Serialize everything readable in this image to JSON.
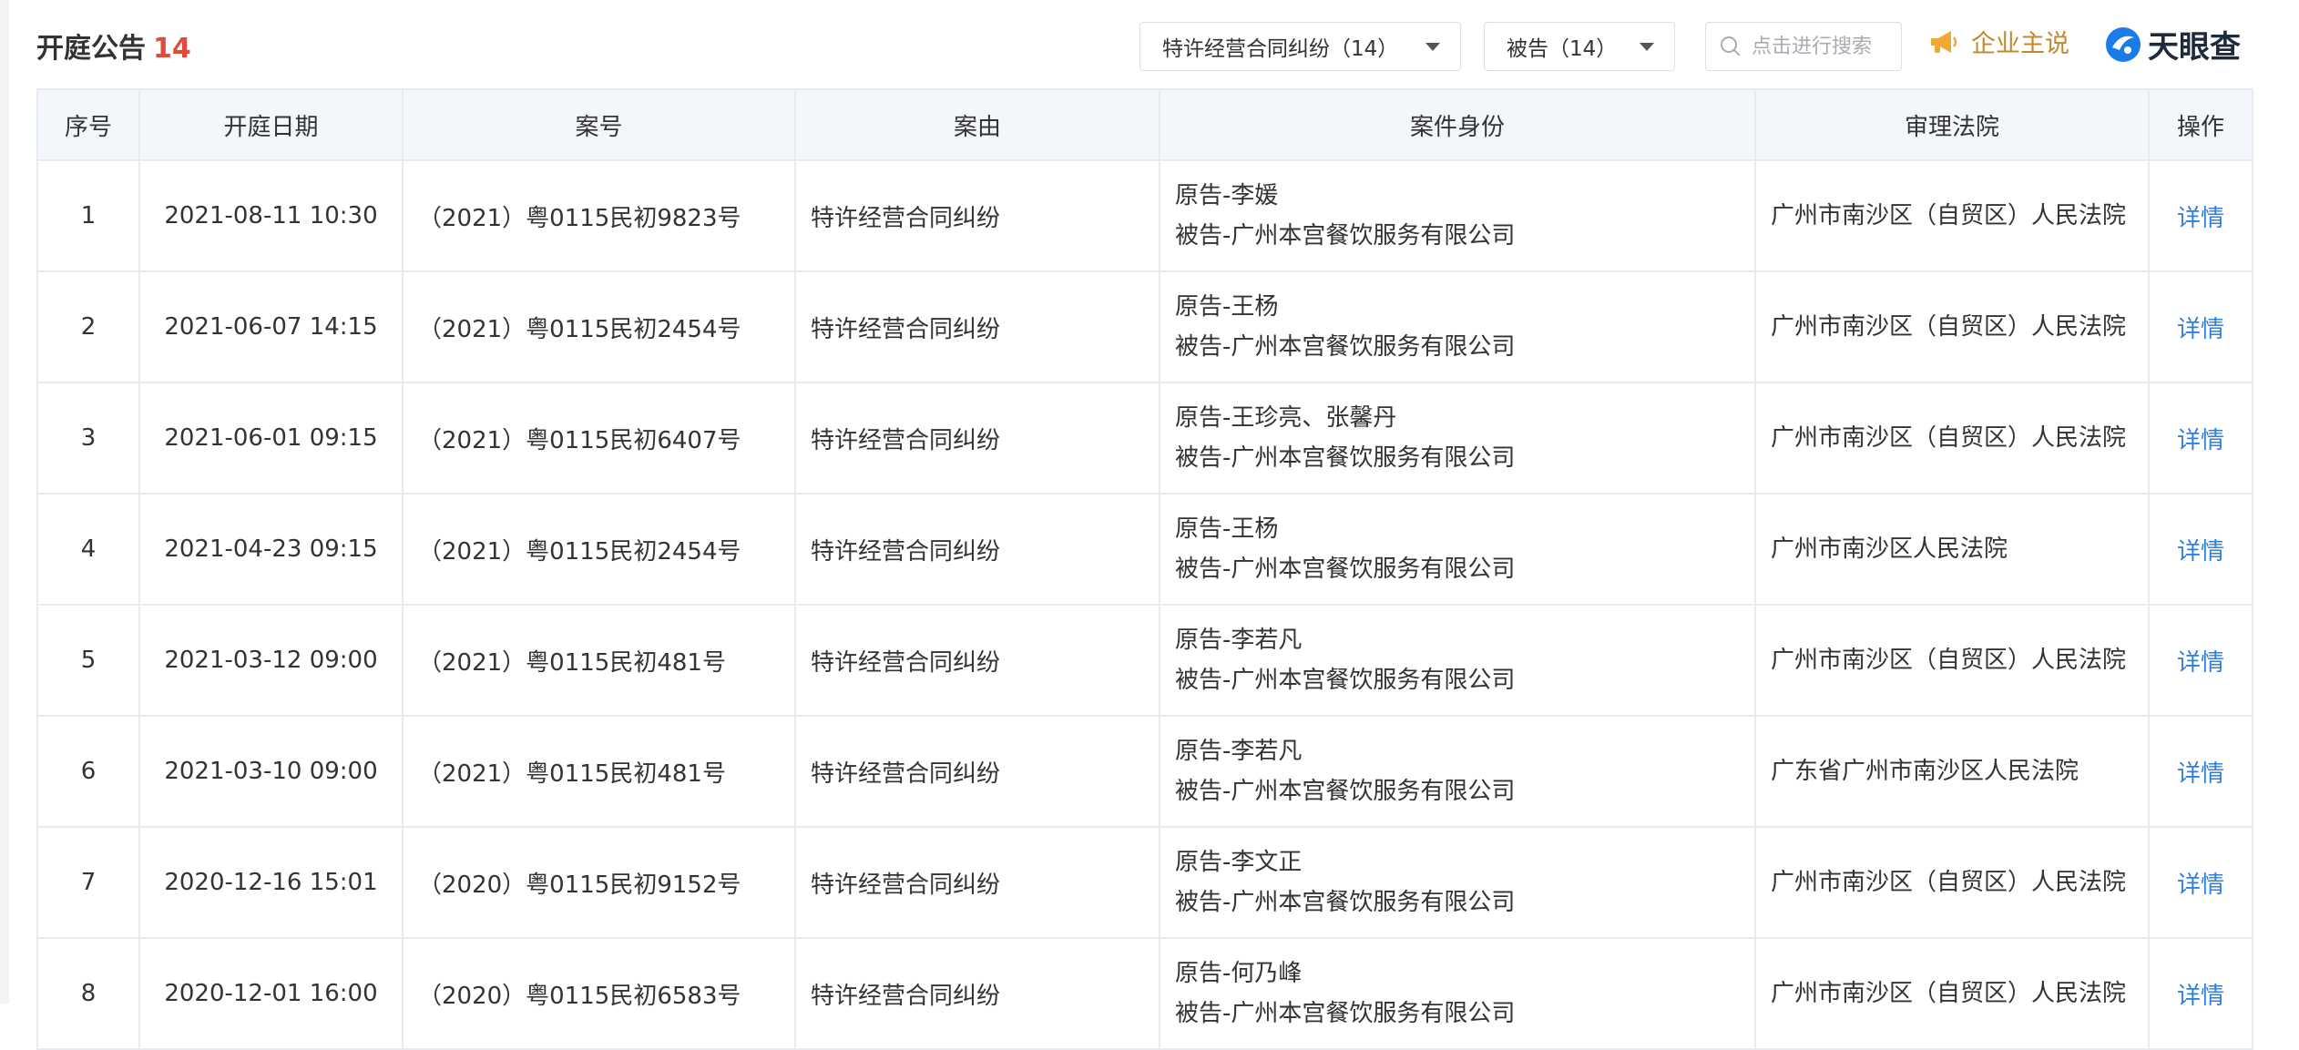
{
  "header": {
    "title": "开庭公告",
    "count": "14",
    "filter_cause": "特许经营合同纠纷（14）",
    "filter_role": "被告（14）",
    "search_placeholder": "点击进行搜索",
    "voice_label": "企业主说",
    "brand": "天眼查"
  },
  "colors": {
    "accent": "#2f7fe0",
    "count": "#e14b3b",
    "voice": "#c08a2e"
  },
  "table": {
    "headers": [
      "序号",
      "开庭日期",
      "案号",
      "案由",
      "案件身份",
      "审理法院",
      "操作"
    ],
    "rows": [
      {
        "no": "1",
        "date": "2021-08-11 10:30",
        "case_no": "（2021）粤0115民初9823号",
        "cause": "特许经营合同纠纷",
        "plaintiff": "原告-李媛",
        "defendant": "被告-广州本宫餐饮服务有限公司",
        "court": "广州市南沙区（自贸区）人民法院",
        "action": "详情"
      },
      {
        "no": "2",
        "date": "2021-06-07 14:15",
        "case_no": "（2021）粤0115民初2454号",
        "cause": "特许经营合同纠纷",
        "plaintiff": "原告-王杨",
        "defendant": "被告-广州本宫餐饮服务有限公司",
        "court": "广州市南沙区（自贸区）人民法院",
        "action": "详情"
      },
      {
        "no": "3",
        "date": "2021-06-01 09:15",
        "case_no": "（2021）粤0115民初6407号",
        "cause": "特许经营合同纠纷",
        "plaintiff": "原告-王珍亮、张馨丹",
        "defendant": "被告-广州本宫餐饮服务有限公司",
        "court": "广州市南沙区（自贸区）人民法院",
        "action": "详情"
      },
      {
        "no": "4",
        "date": "2021-04-23 09:15",
        "case_no": "（2021）粤0115民初2454号",
        "cause": "特许经营合同纠纷",
        "plaintiff": "原告-王杨",
        "defendant": "被告-广州本宫餐饮服务有限公司",
        "court": "广州市南沙区人民法院",
        "action": "详情"
      },
      {
        "no": "5",
        "date": "2021-03-12 09:00",
        "case_no": "（2021）粤0115民初481号",
        "cause": "特许经营合同纠纷",
        "plaintiff": "原告-李若凡",
        "defendant": "被告-广州本宫餐饮服务有限公司",
        "court": "广州市南沙区（自贸区）人民法院",
        "action": "详情"
      },
      {
        "no": "6",
        "date": "2021-03-10 09:00",
        "case_no": "（2021）粤0115民初481号",
        "cause": "特许经营合同纠纷",
        "plaintiff": "原告-李若凡",
        "defendant": "被告-广州本宫餐饮服务有限公司",
        "court": "广东省广州市南沙区人民法院",
        "action": "详情"
      },
      {
        "no": "7",
        "date": "2020-12-16 15:01",
        "case_no": "（2020）粤0115民初9152号",
        "cause": "特许经营合同纠纷",
        "plaintiff": "原告-李文正",
        "defendant": "被告-广州本宫餐饮服务有限公司",
        "court": "广州市南沙区（自贸区）人民法院",
        "action": "详情"
      },
      {
        "no": "8",
        "date": "2020-12-01 16:00",
        "case_no": "（2020）粤0115民初6583号",
        "cause": "特许经营合同纠纷",
        "plaintiff": "原告-何乃峰",
        "defendant": "被告-广州本宫餐饮服务有限公司",
        "court": "广州市南沙区（自贸区）人民法院",
        "action": "详情"
      }
    ]
  }
}
